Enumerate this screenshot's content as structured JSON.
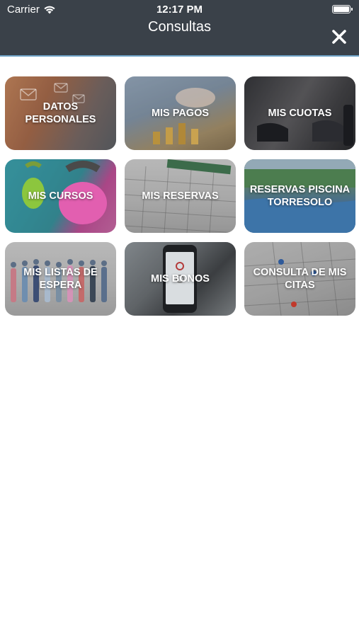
{
  "status_bar": {
    "carrier": "Carrier",
    "time": "12:17 PM",
    "icons": [
      "wifi-icon",
      "battery-icon"
    ]
  },
  "header": {
    "title": "Consultas",
    "close_icon": "close-icon"
  },
  "colors": {
    "header_bg": "#3a4149",
    "header_divider": "#6fa3c7",
    "tile_text": "#ffffff",
    "page_bg": "#ffffff"
  },
  "tiles": [
    {
      "label": "DATOS PERSONALES",
      "name": "datos-personales"
    },
    {
      "label": "MIS PAGOS",
      "name": "mis-pagos"
    },
    {
      "label": "MIS CUOTAS",
      "name": "mis-cuotas"
    },
    {
      "label": "MIS CURSOS",
      "name": "mis-cursos"
    },
    {
      "label": "MIS RESERVAS",
      "name": "mis-reservas"
    },
    {
      "label": "RESERVAS PISCINA TORRESOLO",
      "name": "reservas-piscina-torresolo"
    },
    {
      "label": "MIS LISTAS DE ESPERA",
      "name": "mis-listas-de-espera"
    },
    {
      "label": "MIS BONOS",
      "name": "mis-bonos"
    },
    {
      "label": "CONSULTA DE MIS CITAS",
      "name": "consulta-de-mis-citas"
    }
  ]
}
